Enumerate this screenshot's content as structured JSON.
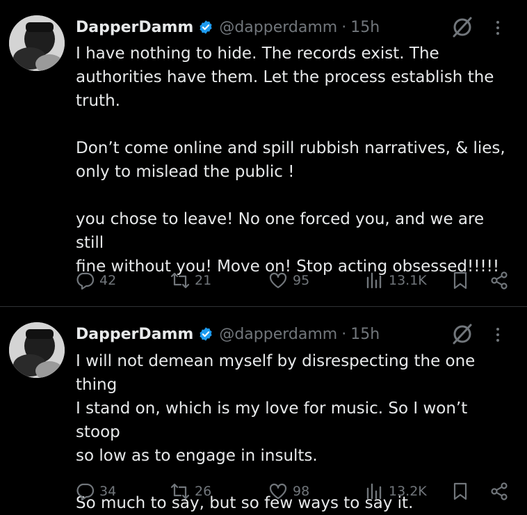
{
  "tweets": [
    {
      "author": {
        "name": "DapperDamm",
        "handle": "@dapperdamm",
        "time": "15h",
        "separator": "·"
      },
      "paragraphs": [
        [
          "I have nothing to hide. The records exist. The",
          "authorities have them. Let the process establish the",
          "truth."
        ],
        [
          "Don’t come online and spill rubbish narratives, & lies,",
          "only to mislead the public !"
        ],
        [
          "you chose to leave! No one forced you, and we are still",
          "fine without you! Move on! Stop acting obsessed!!!!!"
        ]
      ],
      "stats": {
        "replies": "42",
        "reposts": "21",
        "likes": "95",
        "views": "13.1K"
      }
    },
    {
      "author": {
        "name": "DapperDamm",
        "handle": "@dapperdamm",
        "time": "15h",
        "separator": "·"
      },
      "paragraphs": [
        [
          "I will not demean myself by disrespecting the one thing",
          "I stand on, which is my love for music. So I won’t stoop",
          "so low as to engage in insults."
        ],
        [
          "So much to say, but so few ways to say it."
        ]
      ],
      "stats": {
        "replies": "34",
        "reposts": "26",
        "likes": "98",
        "views": "13.2K"
      }
    }
  ],
  "icons": {
    "verified": "verified-badge-icon",
    "grok": "grok-icon",
    "more": "more-dots-icon",
    "reply": "reply-bubble-icon",
    "repost": "repost-arrows-icon",
    "like": "heart-icon",
    "views": "views-bars-icon",
    "bookmark": "bookmark-icon",
    "share": "share-icon"
  },
  "colors": {
    "background": "#000000",
    "text": "#e7e9ea",
    "muted": "#71767b",
    "verified": "#1d9bf0",
    "divider": "#2f3336"
  }
}
